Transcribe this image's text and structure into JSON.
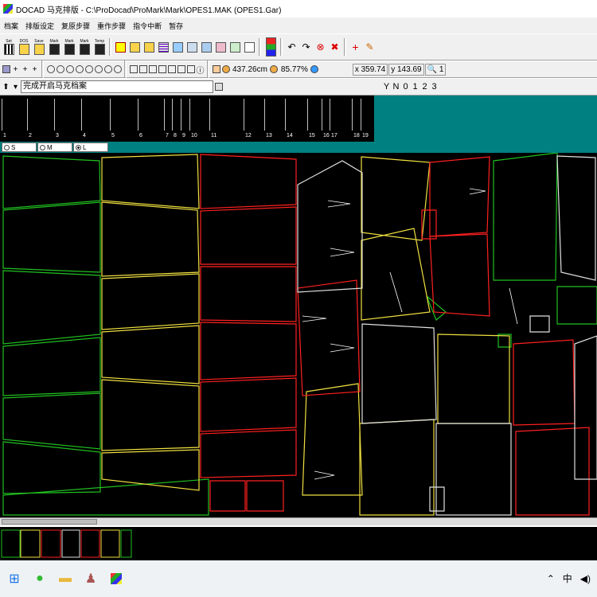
{
  "window": {
    "title": "DOCAD 马克排版 - C:\\ProDocad\\ProMark\\Mark\\OPES1.MAK (OPES1.Gar)"
  },
  "menu": {
    "items": [
      "档案",
      "排版设定",
      "复原步骤",
      "重作步骤",
      "指令中断",
      "暂存"
    ]
  },
  "toolbar1": {
    "labels": [
      "Set",
      "DOS",
      "Save",
      "Mark",
      "Mark",
      "Mark",
      "Temp"
    ]
  },
  "toolbar2": {
    "length": "437.26cm",
    "efficiency": "85.77%",
    "x_label": "x",
    "x_value": "359.74",
    "y_label": "y",
    "y_value": "143.69",
    "count": "1"
  },
  "command": {
    "prompt": "完成开启马克档案",
    "layers": [
      "Y",
      "N",
      "0",
      "1",
      "2",
      "3"
    ]
  },
  "ruler": {
    "numbers": [
      "1",
      "2",
      "3",
      "4",
      "5",
      "6",
      "7",
      "8",
      "9",
      "10",
      "11",
      "12",
      "13",
      "14",
      "15",
      "16",
      "17",
      "18",
      "19"
    ]
  },
  "sizes": {
    "options": [
      "S",
      "M",
      "L"
    ],
    "selected": "L"
  },
  "colors": {
    "canvas_bg": "#000000",
    "piece_red": "#ff2020",
    "piece_yellow": "#f0e040",
    "piece_green": "#20c020",
    "piece_white": "#e0e0e0",
    "ruler_bg": "#008080"
  },
  "taskbar": {
    "ime": "中"
  }
}
